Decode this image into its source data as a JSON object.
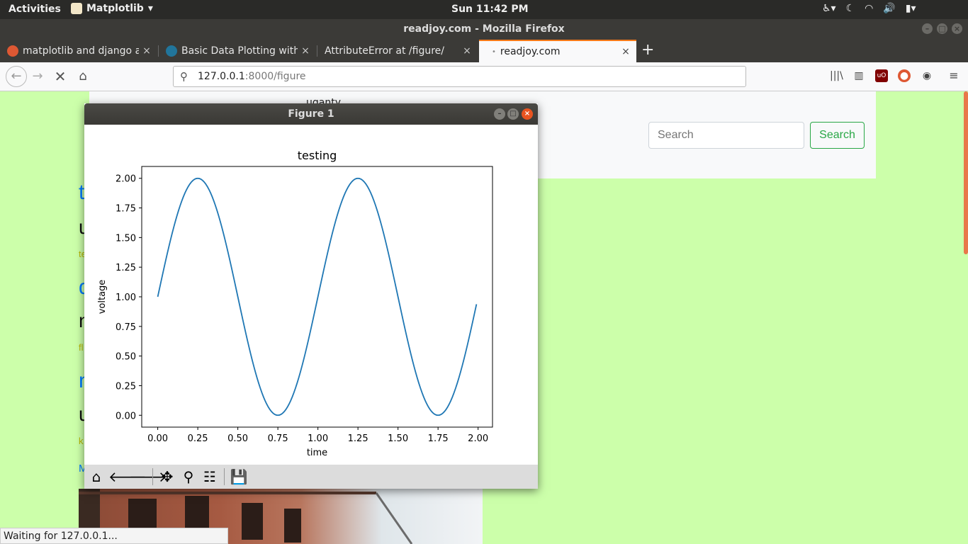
{
  "system": {
    "activities": "Activities",
    "app_name": "Matplotlib",
    "clock": "Sun 11:42 PM"
  },
  "window": {
    "title": "readjoy.com - Mozilla Firefox"
  },
  "tabs": [
    {
      "label": "matplotlib and django a",
      "icon": "duckduckgo-icon"
    },
    {
      "label": "Basic Data Plotting with",
      "icon": "wordpress-icon"
    },
    {
      "label": "AttributeError at /figure/",
      "icon": ""
    },
    {
      "label": "readjoy.com",
      "icon": "loading-dot-icon"
    }
  ],
  "nav": {
    "url_host": "127.0.0.1",
    "url_rest": ":8000/figure"
  },
  "page": {
    "brand": "uganty",
    "search_placeholder": "Search",
    "search_button": "Search",
    "fragments": [
      "t",
      "u",
      "te",
      "d",
      "n",
      "fl",
      "n",
      "u",
      "k",
      "M"
    ]
  },
  "status": "Waiting for 127.0.0.1...",
  "figure": {
    "window_title": "Figure 1",
    "toolbar": [
      "home-icon",
      "back-icon",
      "forward-icon",
      "pan-icon",
      "zoom-icon",
      "configure-icon",
      "save-icon"
    ]
  },
  "chart_data": {
    "type": "line",
    "title": "testing",
    "xlabel": "time",
    "ylabel": "voltage",
    "x_start": 0.0,
    "x_end": 1.99,
    "x_step": 0.01,
    "function": "1 + sin(2*pi*t)",
    "series": [
      {
        "x": [
          0.0,
          0.125,
          0.25,
          0.375,
          0.5,
          0.625,
          0.75,
          0.875,
          1.0,
          1.125,
          1.25,
          1.375,
          1.5,
          1.625,
          1.75,
          1.875,
          1.99
        ],
        "values": [
          1.0,
          1.71,
          2.0,
          1.71,
          1.0,
          0.29,
          0.0,
          0.29,
          1.0,
          1.71,
          2.0,
          1.71,
          1.0,
          0.29,
          0.0,
          0.29,
          0.94
        ]
      }
    ],
    "xlim": [
      -0.1,
      2.09
    ],
    "ylim": [
      -0.1,
      2.1
    ],
    "xticks": [
      "0.00",
      "0.25",
      "0.50",
      "0.75",
      "1.00",
      "1.25",
      "1.50",
      "1.75",
      "2.00"
    ],
    "yticks": [
      "0.00",
      "0.25",
      "0.50",
      "0.75",
      "1.00",
      "1.25",
      "1.50",
      "1.75",
      "2.00"
    ],
    "line_color": "#1f77b4",
    "grid": false
  }
}
